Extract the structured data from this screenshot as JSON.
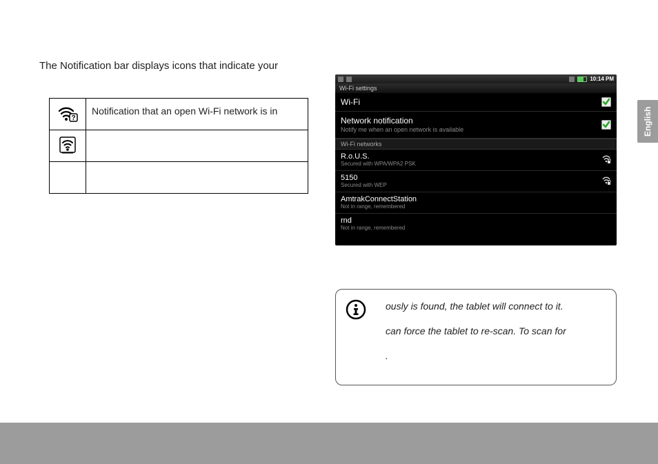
{
  "intro_text": "The Notification bar displays icons that indicate your",
  "icon_table": {
    "rows": [
      {
        "desc": "Notification that an open Wi-Fi network is in"
      },
      {
        "desc": ""
      },
      {
        "desc": ""
      }
    ]
  },
  "side_tab": "English",
  "callout": {
    "line1": "ously is found, the tablet will connect to it.",
    "line2": "can force the tablet to re-scan. To scan for",
    "line3": "."
  },
  "screenshot": {
    "status": {
      "time": "10:14 PM"
    },
    "screen_title": "Wi-Fi settings",
    "wifi_toggle": {
      "title": "Wi-Fi",
      "checked": true
    },
    "net_notif": {
      "title": "Network notification",
      "sub": "Notify me when an open network is available",
      "checked": true
    },
    "section_header": "Wi-Fi networks",
    "networks": [
      {
        "name": "R.o.U.S.",
        "sub": "Secured with WPA/WPA2 PSK",
        "lock": true
      },
      {
        "name": "5150",
        "sub": "Secured with WEP",
        "lock": true
      },
      {
        "name": "AmtrakConnectStation",
        "sub": "Not in range, remembered",
        "lock": false
      },
      {
        "name": "rnd",
        "sub": "Not in range, remembered",
        "lock": false
      }
    ]
  }
}
